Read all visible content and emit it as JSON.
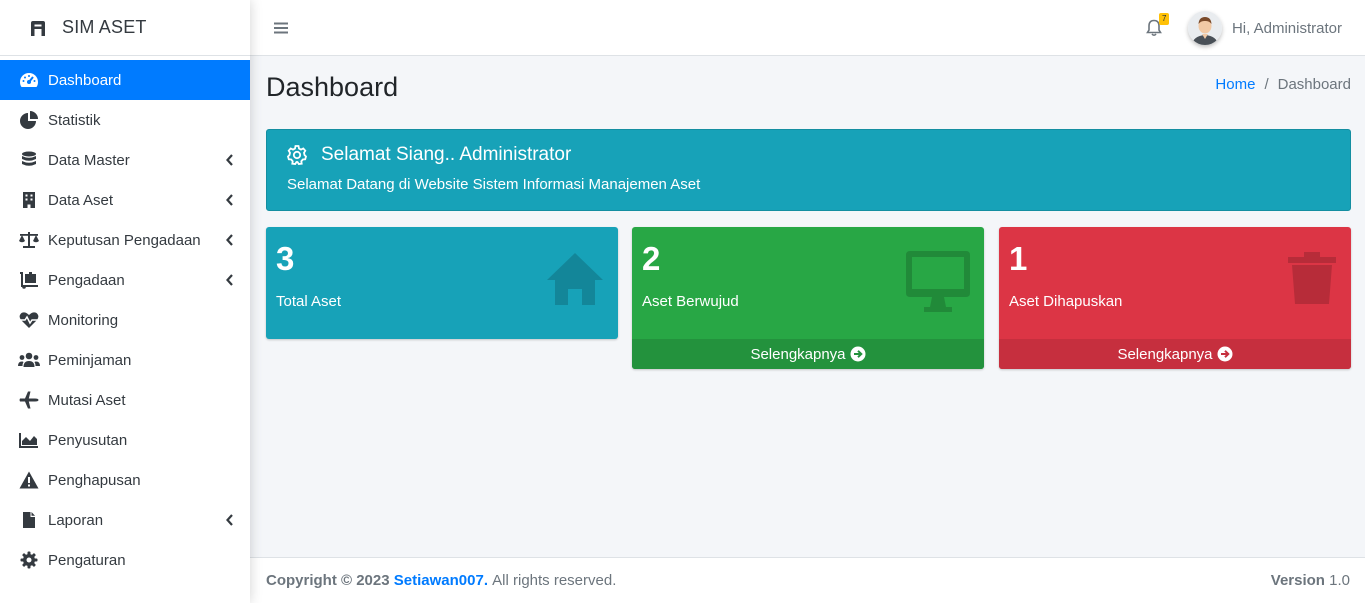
{
  "brand": {
    "title": "SIM ASET"
  },
  "sidebar": {
    "items": [
      {
        "label": "Dashboard",
        "icon": "tachometer-icon",
        "active": true,
        "has_children": false
      },
      {
        "label": "Statistik",
        "icon": "pie-chart-icon",
        "has_children": false
      },
      {
        "label": "Data Master",
        "icon": "database-icon",
        "has_children": true
      },
      {
        "label": "Data Aset",
        "icon": "building-icon",
        "has_children": true
      },
      {
        "label": "Keputusan Pengadaan",
        "icon": "balance-scale-icon",
        "has_children": true
      },
      {
        "label": "Pengadaan",
        "icon": "dolly-icon",
        "has_children": true
      },
      {
        "label": "Monitoring",
        "icon": "heartbeat-icon",
        "has_children": false
      },
      {
        "label": "Peminjaman",
        "icon": "users-icon",
        "has_children": false
      },
      {
        "label": "Mutasi Aset",
        "icon": "plane-icon",
        "has_children": false
      },
      {
        "label": "Penyusutan",
        "icon": "area-chart-icon",
        "has_children": false
      },
      {
        "label": "Penghapusan",
        "icon": "warning-icon",
        "has_children": false
      },
      {
        "label": "Laporan",
        "icon": "file-icon",
        "has_children": true
      },
      {
        "label": "Pengaturan",
        "icon": "gear-icon",
        "has_children": false
      }
    ]
  },
  "topbar": {
    "notification_count": "7",
    "user_greeting": "Hi, Administrator"
  },
  "page": {
    "title": "Dashboard",
    "breadcrumb": {
      "home": "Home",
      "separator": "/",
      "current": "Dashboard"
    }
  },
  "alert": {
    "heading": "Selamat Siang.. Administrator",
    "body": "Selamat Datang di Website Sistem Informasi Manajemen Aset"
  },
  "boxes": [
    {
      "count": "3",
      "label": "Total Aset",
      "icon": "home-icon",
      "color": "#17a2b8"
    },
    {
      "count": "2",
      "label": "Aset Berwujud",
      "icon": "desktop-icon",
      "link": "Selengkapnya",
      "color": "#28a745"
    },
    {
      "count": "1",
      "label": "Aset Dihapuskan",
      "icon": "trash-icon",
      "link": "Selengkapnya",
      "color": "#dc3545"
    }
  ],
  "footer": {
    "copyright_prefix": "Copyright © 2023",
    "author": "Setiawan007.",
    "rights": "All rights reserved.",
    "version_label": "Version",
    "version_value": "1.0"
  },
  "colors": {
    "primary": "#007bff",
    "info": "#17a2b8",
    "success": "#28a745",
    "danger": "#dc3545",
    "warning": "#ffc107"
  }
}
